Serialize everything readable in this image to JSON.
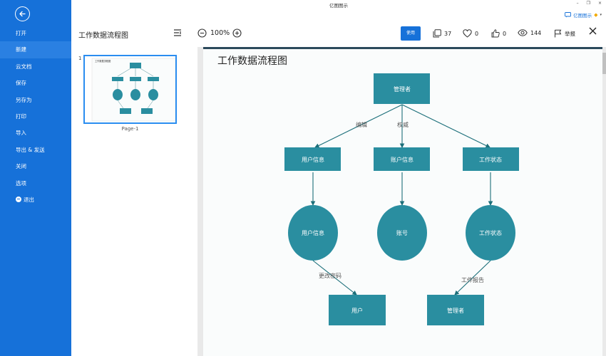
{
  "app": {
    "title": "亿图图示",
    "brand": "亿图图示"
  },
  "window": {
    "minimize": "–",
    "restore": "❐",
    "close": "×"
  },
  "sidebar": {
    "items": [
      {
        "label": "打开"
      },
      {
        "label": "新建"
      },
      {
        "label": "云文档"
      },
      {
        "label": "保存"
      },
      {
        "label": "另存为"
      },
      {
        "label": "打印"
      },
      {
        "label": "导入"
      },
      {
        "label": "导出 & 发送"
      },
      {
        "label": "关闭"
      },
      {
        "label": "选项"
      },
      {
        "label": "退出"
      }
    ],
    "active_index": 1
  },
  "toolbar": {
    "doc_title": "工作数据流程图",
    "zoom": "100%",
    "use_label": "使用",
    "copies": "37",
    "likes": "0",
    "thumbs": "0",
    "views": "144",
    "report_label": "举报"
  },
  "thumbnails": {
    "page_number": "1",
    "page_label": "Page-1"
  },
  "diagram": {
    "title": "工作数据流程图",
    "colors": {
      "node": "#2a8ea0",
      "edge": "#1c6f7a",
      "node_text": "#ffffff",
      "label_text": "#555555"
    },
    "nodes": {
      "top": "管理者",
      "user_info_rect": "用户信息",
      "account_info_rect": "账户信息",
      "work_status_rect": "工作状态",
      "user_info_circle": "用户信息",
      "account_circle": "账号",
      "work_status_circle": "工作状态",
      "user_rect": "用户",
      "manager_rect": "管理者"
    },
    "edge_labels": {
      "edit": "编辑",
      "permission": "权威",
      "change_password": "更改密码",
      "work_report": "工作报告"
    }
  }
}
